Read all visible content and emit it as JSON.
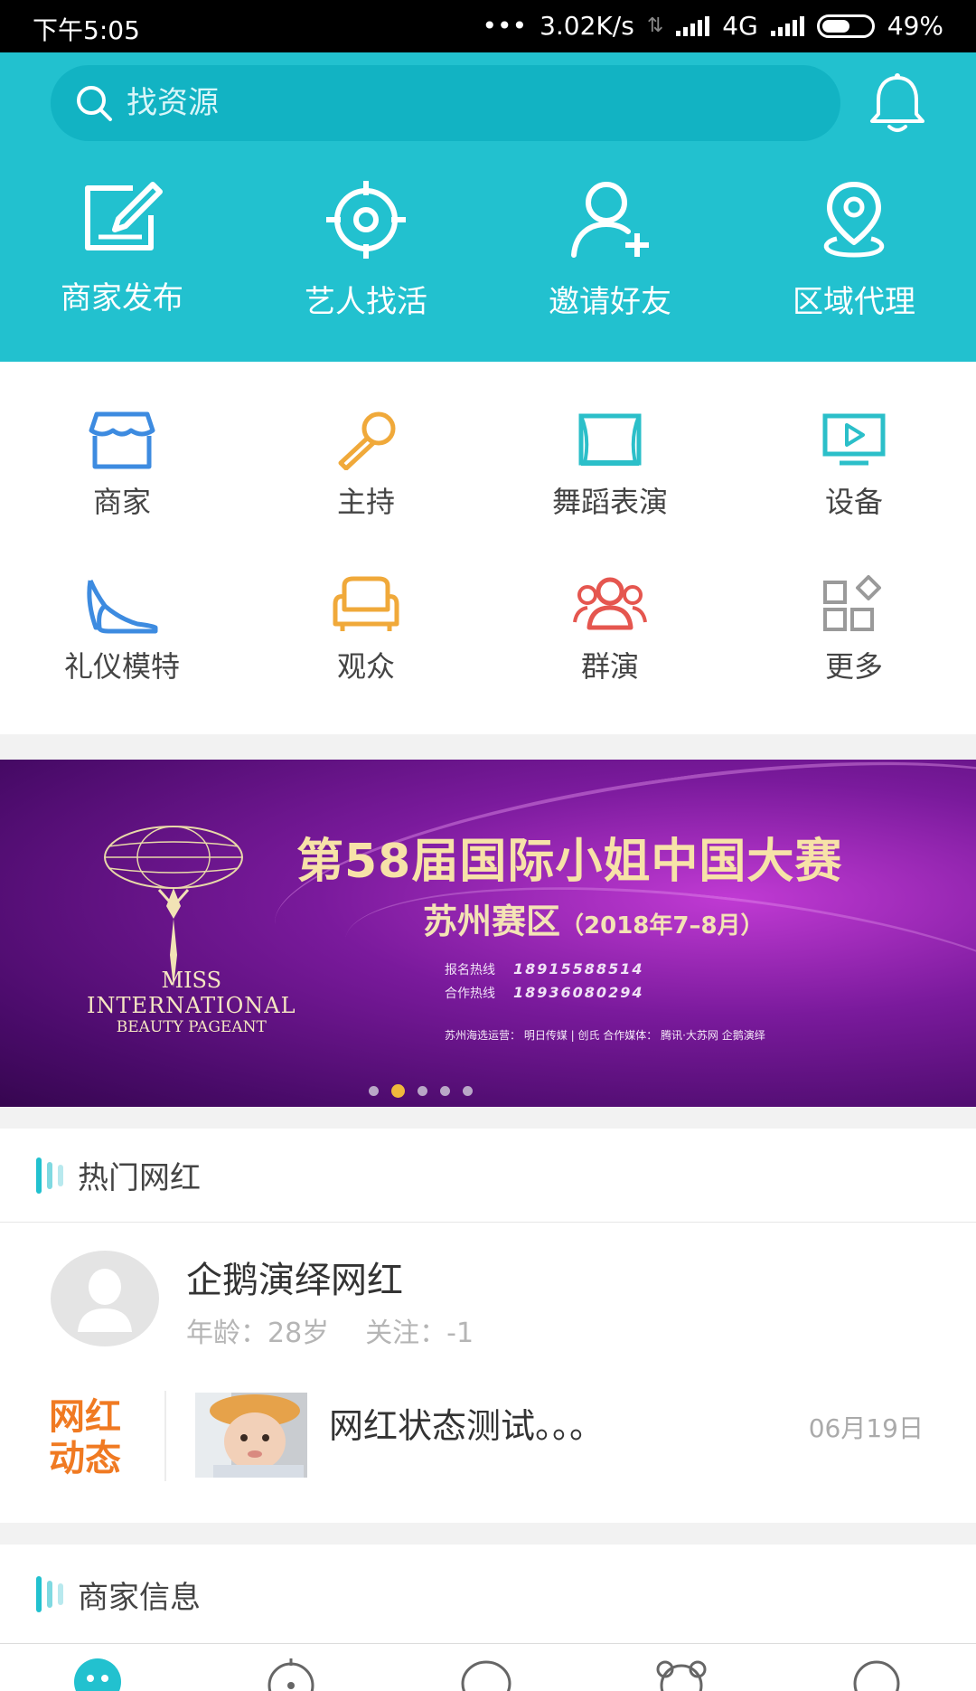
{
  "status_bar": {
    "time": "下午5:05",
    "network_speed": "3.02K/s",
    "network_type": "4G",
    "battery": "49%"
  },
  "search": {
    "placeholder": "找资源"
  },
  "quick_actions": [
    {
      "label": "商家发布",
      "icon": "edit-icon"
    },
    {
      "label": "艺人找活",
      "icon": "target-icon"
    },
    {
      "label": "邀请好友",
      "icon": "add-user-icon"
    },
    {
      "label": "区域代理",
      "icon": "location-icon"
    }
  ],
  "categories": [
    {
      "label": "商家",
      "icon": "shop-icon",
      "color": "#3d8be0"
    },
    {
      "label": "主持",
      "icon": "microphone-icon",
      "color": "#f0a93a"
    },
    {
      "label": "舞蹈表演",
      "icon": "stage-icon",
      "color": "#2bbfc9"
    },
    {
      "label": "设备",
      "icon": "screen-icon",
      "color": "#2bbfc9"
    },
    {
      "label": "礼仪模特",
      "icon": "high-heel-icon",
      "color": "#3d8be0"
    },
    {
      "label": "观众",
      "icon": "sofa-icon",
      "color": "#f0a93a"
    },
    {
      "label": "群演",
      "icon": "group-icon",
      "color": "#e5564f"
    },
    {
      "label": "更多",
      "icon": "grid-icon",
      "color": "#9a9a9a"
    }
  ],
  "banner": {
    "title": "第58届国际小姐中国大赛",
    "subtitle": "苏州赛区",
    "subtitle_date": "（2018年7–8月）",
    "hotline_label": "报名热线",
    "hotline": "18915588514",
    "coop_label": "合作热线",
    "coop": "18936080294",
    "logo_line1": "MISS",
    "logo_line2": "INTERNATIONAL",
    "logo_line3": "BEAUTY PAGEANT",
    "sponsors": "苏州海选运营：  明日传媒  |  创氏   合作媒体：  腾讯·大苏网   企鹅演绎",
    "active_dot": 1,
    "dot_count": 5
  },
  "hot_section": {
    "title": "热门网红",
    "person": {
      "name": "企鹅演绎网红",
      "age": "年龄：28岁",
      "follow": "关注：-1"
    },
    "dynamic": {
      "label": "网红动态",
      "text": "网红状态测试。。。",
      "date": "06月19日"
    }
  },
  "merchant_section": {
    "title": "商家信息"
  },
  "colors": {
    "header": "#22c1cf",
    "accent_orange": "#f07a22"
  }
}
